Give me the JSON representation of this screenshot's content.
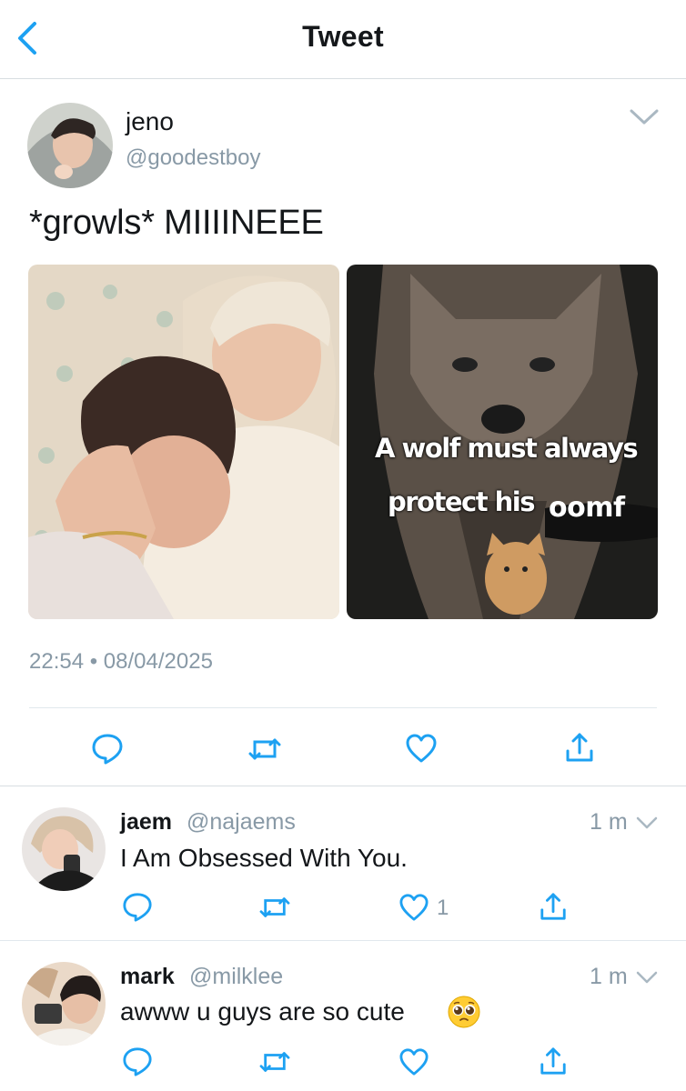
{
  "header": {
    "title": "Tweet"
  },
  "tweet": {
    "author_name": "jeno",
    "author_handle": "@goodestboy",
    "text": "*growls* MIIIINEEE",
    "meme_text_line1": "A wolf must always",
    "meme_text_line2": "protect his",
    "meme_text_highlight": "oomf",
    "timestamp": "22:54 • 08/04/2025"
  },
  "replies": [
    {
      "name": "jaem",
      "handle": "@najaems",
      "time": "1 m",
      "text": "I Am Obsessed With You.",
      "like_count": "1"
    },
    {
      "name": "mark",
      "handle": "@milklee",
      "time": "1 m",
      "text": "awww u guys are so cute",
      "emoji": "pleading-face-emoji"
    }
  ],
  "colors": {
    "accent": "#1da1f2",
    "icon_gray": "#657786",
    "secondary_text": "#8899a6",
    "divider": "#e1e8ed"
  }
}
